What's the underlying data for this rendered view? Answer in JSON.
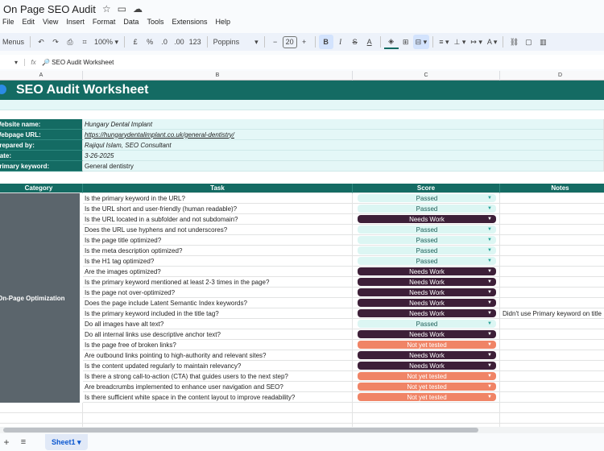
{
  "app": {
    "doc_title": "On Page SEO Audit",
    "menus": [
      "File",
      "Edit",
      "View",
      "Insert",
      "Format",
      "Data",
      "Tools",
      "Extensions",
      "Help"
    ]
  },
  "toolbar": {
    "menus_label": "Menus",
    "zoom": "100%",
    "currency": "£",
    "percent": "%",
    "dec_decrease": ".0",
    "dec_increase": ".00",
    "number_format": "123",
    "font": "Poppins",
    "font_size": "20"
  },
  "formula_bar": {
    "cell_ref": "",
    "content": "🔎 SEO Audit Worksheet"
  },
  "columns": [
    "A",
    "B",
    "C",
    "D"
  ],
  "sheet": {
    "title": "SEO Audit Worksheet",
    "info": [
      {
        "label": "Website name:",
        "value": "Hungary Dental Implant"
      },
      {
        "label": "Webpage URL:",
        "value": "https://hungarydentalimplant.co.uk/general-dentistry/"
      },
      {
        "label": "Prepared by:",
        "value": "Rajiqul Islam, SEO Consultant"
      },
      {
        "label": "Date:",
        "value": "3-26-2025"
      },
      {
        "label": "Primary keyword:",
        "value": "General dentistry"
      }
    ],
    "headers": {
      "category": "Category",
      "task": "Task",
      "score": "Score",
      "notes": "Notes"
    },
    "category": "On-Page Optimization",
    "tasks": [
      {
        "task": "Is the primary keyword in the URL?",
        "score": "Passed",
        "note": ""
      },
      {
        "task": "Is the URL short and user-friendly (human readable)?",
        "score": "Passed",
        "note": ""
      },
      {
        "task": "Is the URL located in a subfolder and not subdomain?",
        "score": "Needs Work",
        "note": ""
      },
      {
        "task": "Does the URL use hyphens and not underscores?",
        "score": "Passed",
        "note": ""
      },
      {
        "task": "Is the page title optimized?",
        "score": "Passed",
        "note": ""
      },
      {
        "task": "Is the meta description optimized?",
        "score": "Passed",
        "note": ""
      },
      {
        "task": "Is the H1 tag optimized?",
        "score": "Passed",
        "note": ""
      },
      {
        "task": "Are the images optimized?",
        "score": "Needs Work",
        "note": ""
      },
      {
        "task": "Is the primary keyword mentioned at least 2-3 times in the page?",
        "score": "Needs Work",
        "note": ""
      },
      {
        "task": "Is the page not over-optimized?",
        "score": "Needs Work",
        "note": ""
      },
      {
        "task": "Does the page include Latent Semantic Index keywords?",
        "score": "Needs Work",
        "note": ""
      },
      {
        "task": "Is the primary keyword included in the title tag?",
        "score": "Needs Work",
        "note": "Didn't use Primary keyword on title"
      },
      {
        "task": "Do all images have alt text?",
        "score": "Passed",
        "note": ""
      },
      {
        "task": "Do all internal links use descriptive anchor text?",
        "score": "Needs Work",
        "note": ""
      },
      {
        "task": "Is the page free of broken links?",
        "score": "Not yet tested",
        "note": ""
      },
      {
        "task": "Are outbound links pointing to high-authority and relevant sites?",
        "score": "Needs Work",
        "note": ""
      },
      {
        "task": "Is the content updated regularly to maintain relevancy?",
        "score": "Needs Work",
        "note": ""
      },
      {
        "task": "Is there a strong call-to-action (CTA) that guides users to the next step?",
        "score": "Not yet tested",
        "note": ""
      },
      {
        "task": "Are breadcrumbs implemented to enhance user navigation and SEO?",
        "score": "Not yet tested",
        "note": ""
      },
      {
        "task": "Is there sufficient white space in the content layout to improve readability?",
        "score": "Not yet tested",
        "note": ""
      }
    ]
  },
  "colors": {
    "header_teal": "#146b63",
    "info_fill": "#e4f7f7",
    "passed_chip": "#dcf6f3",
    "needs_work_chip": "#3d1f38",
    "not_tested_chip": "#f08466",
    "category_fill": "#5b656c"
  },
  "sheet_tabs": [
    "Sheet1"
  ]
}
